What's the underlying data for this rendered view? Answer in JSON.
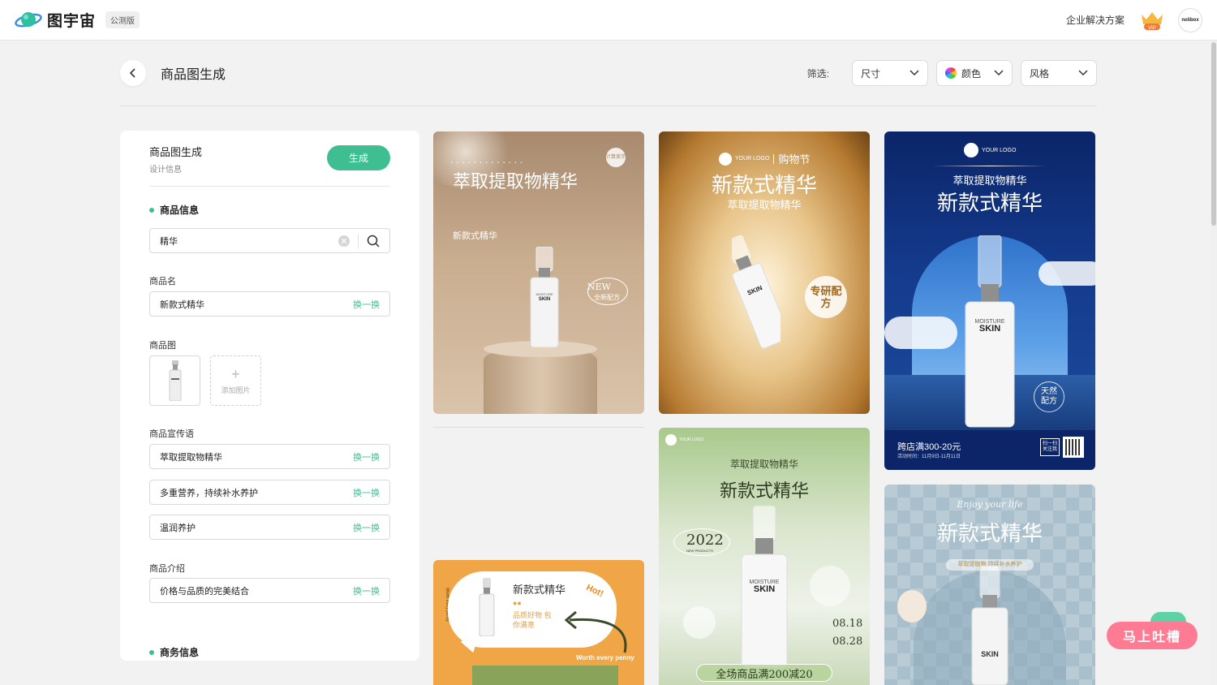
{
  "app": {
    "brand": "图宇宙",
    "beta_badge": "公测版",
    "enterprise_link": "企业解决方案",
    "vip_label": "VIP",
    "avatar_text": "nolibox"
  },
  "header": {
    "title": "商品图生成",
    "filter_label": "筛选:",
    "filters": [
      {
        "label": "尺寸"
      },
      {
        "label": "颜色"
      },
      {
        "label": "风格"
      }
    ]
  },
  "panel": {
    "title": "商品图生成",
    "subtitle": "设计信息",
    "generate_label": "生成",
    "product_info_section": "商品信息",
    "search_value": "精华",
    "name_label": "商品名",
    "name_value": "新款式精华",
    "swap_label": "换一换",
    "image_label": "商品图",
    "add_image_label": "添加图片",
    "slogan_label": "商品宣传语",
    "slogans": [
      "萃取提取物精华",
      "多重营养，持续补水养护",
      "温润养护"
    ],
    "intro_label": "商品介绍",
    "intro_value": "价格与品质的完美结合",
    "business_section": "商务信息"
  },
  "cards": {
    "c1": {
      "title": "萃取提取物精华",
      "sub": "新款式精华",
      "badge_top": "计算美学",
      "new_label": "NEW",
      "new_sub": "全新配方"
    },
    "c2": {
      "logo": "YOUR LOGO",
      "tag": "购物节",
      "title": "新款式精华",
      "sub": "萃取提取物精华",
      "stamp": "专研配方"
    },
    "c3": {
      "logo": "YOUR LOGO",
      "sub": "萃取提取物精华",
      "title": "新款式精华",
      "badge": "天然配方",
      "promo": "跨店满300-20元",
      "date": "活动时间：11月9日-11月11日",
      "qr_label": "扫一扫 关注我"
    },
    "c4": {
      "logo": "YOUR LOGO",
      "sub": "萃取提取物精华",
      "title": "新款式精华",
      "year": "2022",
      "year_sub": "NEW PRODUCTS",
      "date1": "08.18",
      "date2": "08.28",
      "promo": "全场商品满200减20"
    },
    "c5": {
      "title": "新款式精华",
      "tagline": "品质好物 包你满意",
      "hot": "Hot!",
      "footer": "Worth every penny",
      "side": "Worth every penny"
    },
    "c6": {
      "script": "Enjoy your life",
      "title": "新款式精华",
      "sub": "萃取提取物 持续补水养护"
    }
  },
  "bottle_text": {
    "brand1": "MOISTURE",
    "brand2": "SKIN",
    "line": "WHITENING SKINCARE"
  },
  "feedback": {
    "label": "马上吐槽"
  },
  "colors": {
    "accent": "#3fbf91",
    "feedback": "#ff7a93"
  }
}
